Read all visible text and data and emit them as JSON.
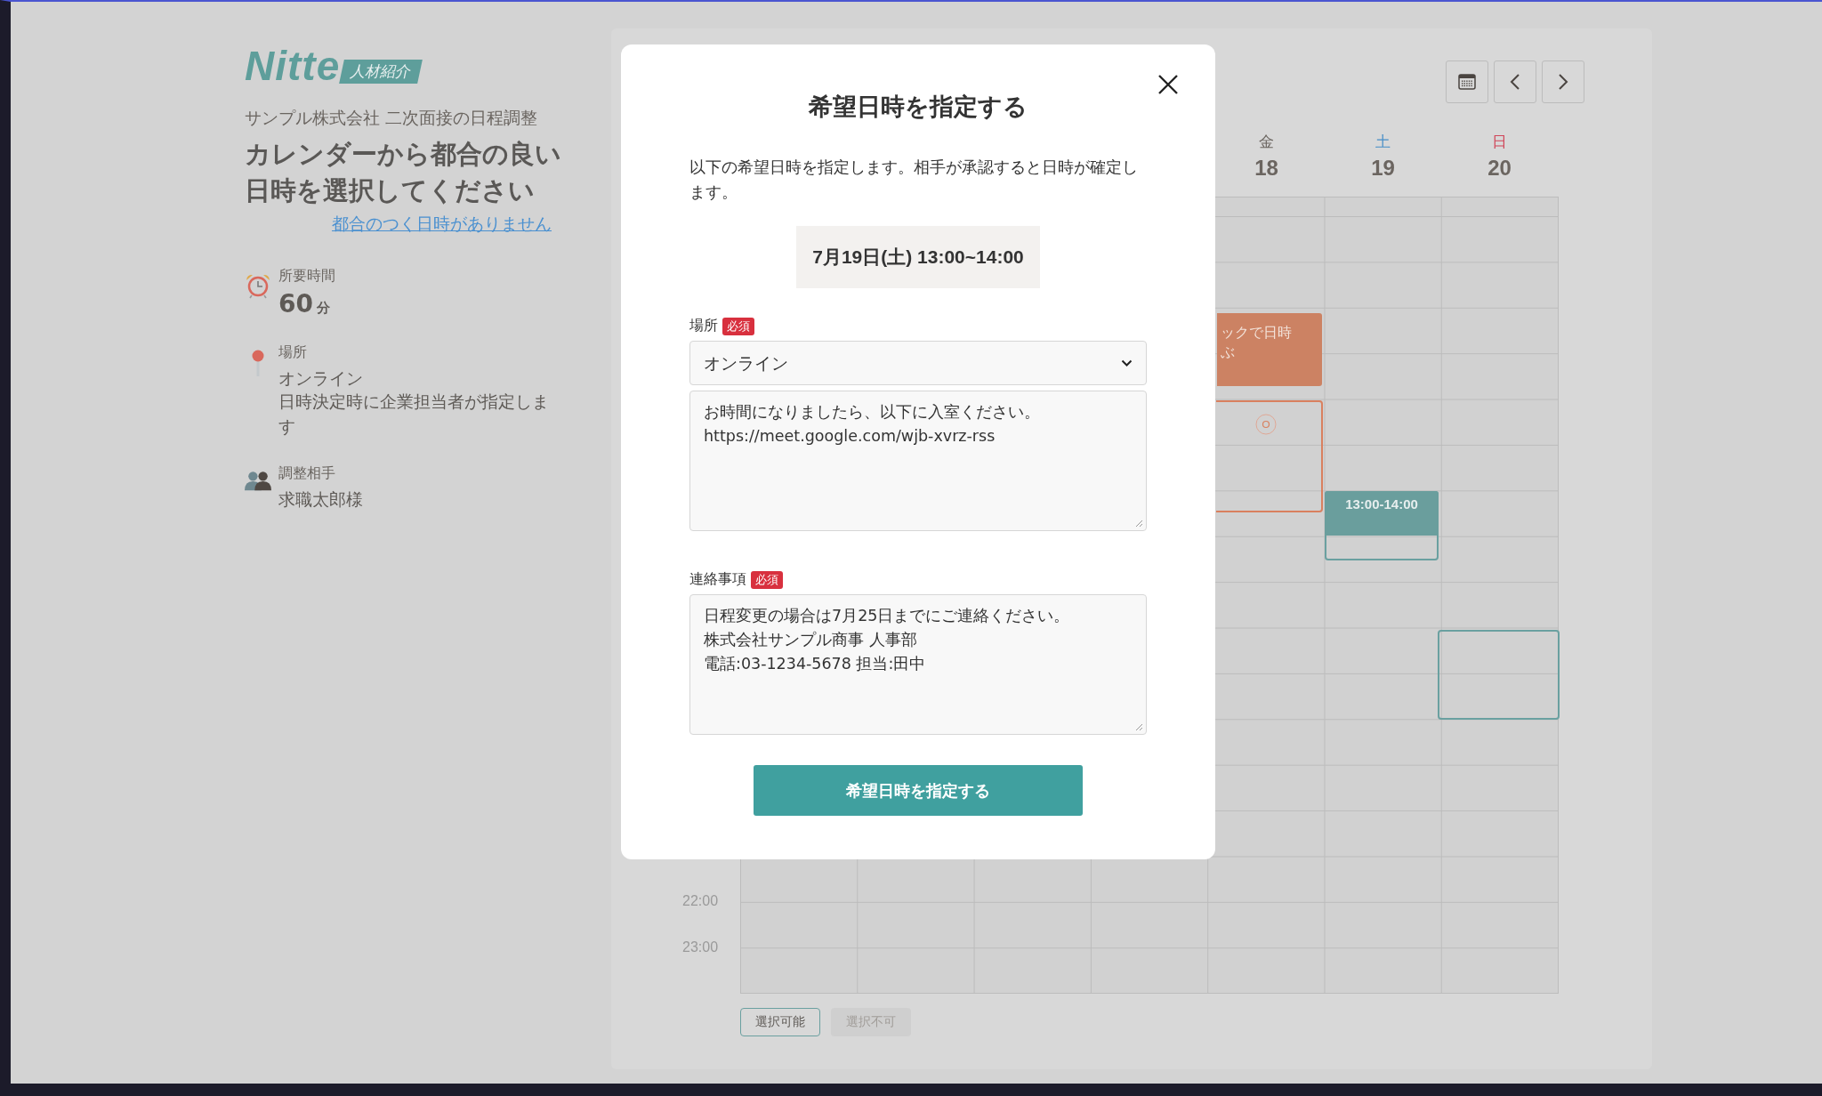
{
  "logo": {
    "wordmark": "Nitte",
    "badge": "人材紹介"
  },
  "intro": {
    "subtitle": "サンプル株式会社 二次面接の日程調整",
    "heading": "カレンダーから都合の良い日時を選択してください",
    "link": "都合のつく日時がありません"
  },
  "info": [
    {
      "kind": "duration",
      "label": "所要時間",
      "value": "60",
      "unit": "分"
    },
    {
      "kind": "location",
      "label": "場所",
      "value": "オンライン",
      "note": "日時決定時に企業担当者が指定します"
    },
    {
      "kind": "person",
      "label": "調整相手",
      "value": "求職太郎様"
    }
  ],
  "calendar": {
    "days": [
      {
        "weekday": "金",
        "date": "18",
        "color": "#6b6560"
      },
      {
        "weekday": "土",
        "date": "19",
        "color": "#4a90c8"
      },
      {
        "weekday": "日",
        "date": "20",
        "color": "#d0475a"
      }
    ],
    "time_labels": [
      "22:00",
      "23:00"
    ],
    "hint_lines": [
      "ックで日時",
      "ぶ"
    ],
    "selected_slot": "13:00-14:00",
    "legend": [
      {
        "kind": "available",
        "label": "選択可能"
      },
      {
        "kind": "unavailable",
        "label": "選択不可"
      }
    ]
  },
  "modal": {
    "title": "希望日時を指定する",
    "description": "以下の希望日時を指定します。相手が承認すると日時が確定します。",
    "datetime": "7月19日(土) 13:00~14:00",
    "fields": [
      {
        "kind": "select",
        "label": "場所",
        "badge": "必須",
        "value": "オンライン",
        "details": [
          "お時間になりましたら、以下に入室ください。",
          "https://meet.google.com/wjb-xvrz-rss"
        ]
      },
      {
        "kind": "textarea",
        "label": "連絡事項",
        "badge": "必須",
        "lines": [
          "日程変更の場合は7月25日までにご連絡ください。",
          "株式会社サンプル商事 人事部",
          "電話:03-1234-5678 担当:田中"
        ]
      }
    ],
    "submit": "希望日時を指定する"
  }
}
